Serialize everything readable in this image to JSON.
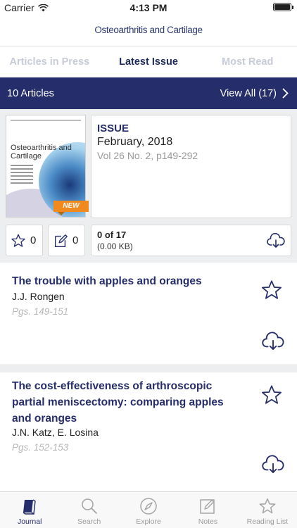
{
  "status_bar": {
    "carrier": "Carrier",
    "time": "4:13 PM"
  },
  "header": {
    "logo_text": "Osteoarthritis and Cartilage"
  },
  "tabs": [
    {
      "label": "Articles in Press",
      "active": false
    },
    {
      "label": "Latest Issue",
      "active": true
    },
    {
      "label": "Most Read",
      "active": false
    }
  ],
  "banner": {
    "count_label": "10 Articles",
    "view_all_label": "View All (17)"
  },
  "issue": {
    "cover_title": "Osteoarthritis and Cartilage",
    "badge": "NEW",
    "kind": "ISSUE",
    "date": "February, 2018",
    "volume": "Vol 26 No. 2, p149-292",
    "star_count": "0",
    "note_count": "0",
    "downloaded": "0 of 17",
    "size": "(0.00 KB)"
  },
  "articles": [
    {
      "title": "The trouble with apples and oranges",
      "authors": "J.J. Rongen",
      "pages": "Pgs. 149-151"
    },
    {
      "title": "The cost-effectiveness of arthroscopic partial meniscectomy: comparing apples and oranges",
      "authors": "J.N. Katz, E. Losina",
      "pages": "Pgs. 152-153"
    }
  ],
  "tabbar": [
    {
      "label": "Journal",
      "icon": "journal-icon",
      "active": true
    },
    {
      "label": "Search",
      "icon": "search-icon",
      "active": false
    },
    {
      "label": "Explore",
      "icon": "compass-icon",
      "active": false
    },
    {
      "label": "Notes",
      "icon": "notes-icon",
      "active": false
    },
    {
      "label": "Reading List",
      "icon": "star-icon",
      "active": false
    }
  ],
  "colors": {
    "brand_navy": "#262d6b",
    "badge_orange": "#f08a1e",
    "muted_tab": "#c8cbd8"
  }
}
